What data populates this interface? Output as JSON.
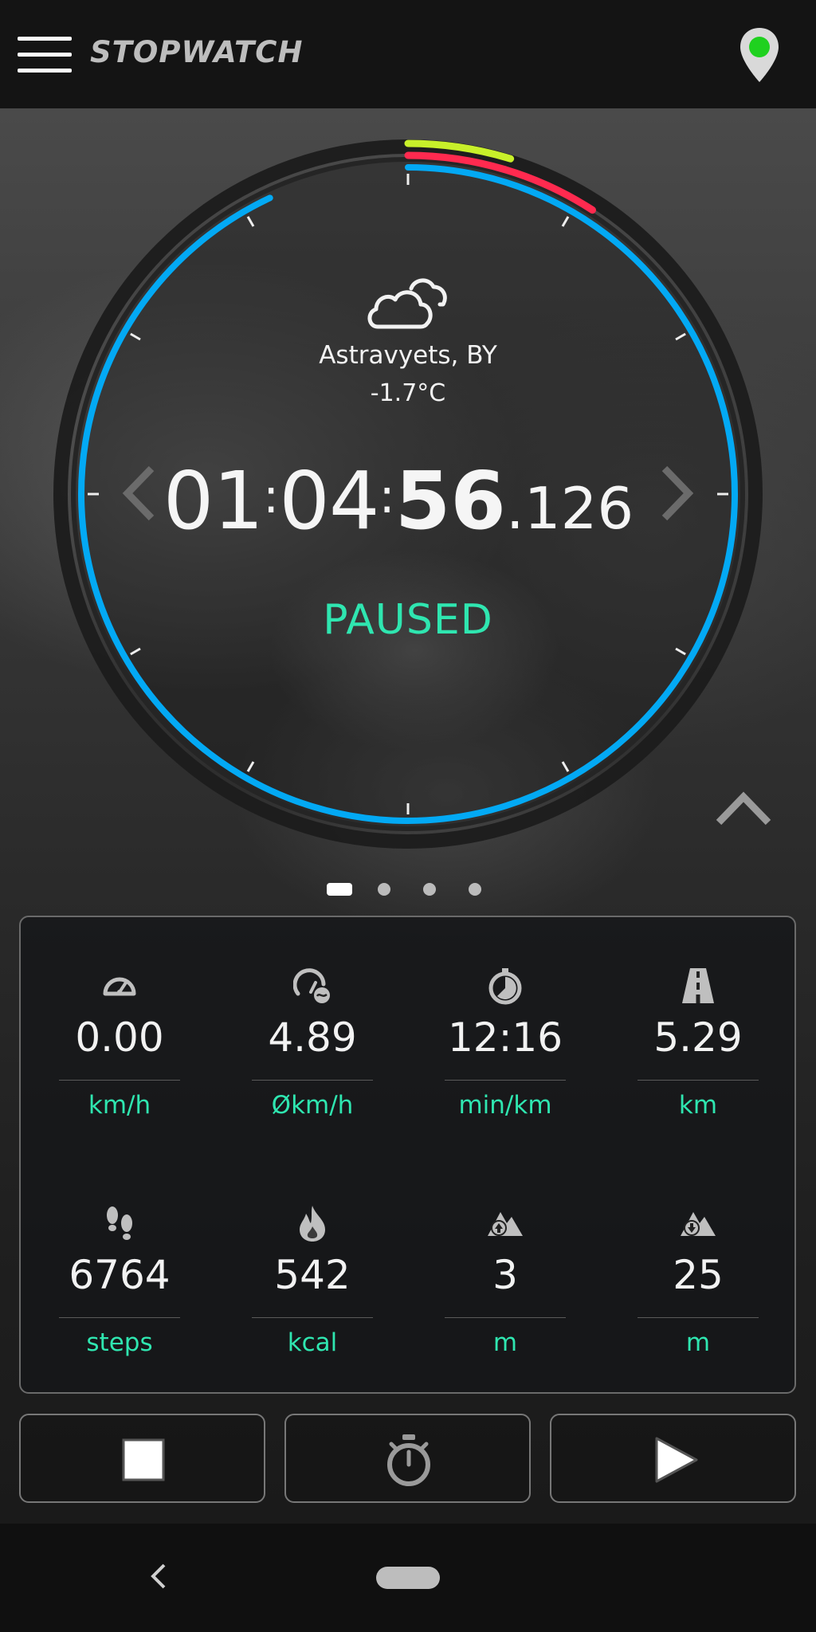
{
  "header": {
    "title": "STOPWATCH",
    "menu_icon": "hamburger-menu-icon",
    "gps_icon": "location-pin-icon",
    "gps_status_color": "#1fd11f"
  },
  "weather": {
    "icon": "cloudy-icon",
    "location": "Astravyets, BY",
    "temperature": "-1.7°C"
  },
  "timer": {
    "hours": "01",
    "minutes": "04",
    "seconds": "56",
    "milliseconds": ".126",
    "separator": ":",
    "status": "PAUSED"
  },
  "dial_colors": {
    "ring": "#03a9f4",
    "goal_red": "#ff2a4f",
    "goal_yellow": "#c8f02a",
    "status": "#2fe6b0"
  },
  "pager": {
    "count": 4,
    "active_index": 0
  },
  "stats": [
    {
      "icon": "speedometer-icon",
      "value": "0.00",
      "unit": "km/h"
    },
    {
      "icon": "average-speed-icon",
      "value": "4.89",
      "unit": "Økm/h"
    },
    {
      "icon": "pace-timer-icon",
      "value": "12:16",
      "unit": "min/km"
    },
    {
      "icon": "road-distance-icon",
      "value": "5.29",
      "unit": "km"
    },
    {
      "icon": "footsteps-icon",
      "value": "6764",
      "unit": "steps"
    },
    {
      "icon": "flame-calories-icon",
      "value": "542",
      "unit": "kcal"
    },
    {
      "icon": "elevation-up-icon",
      "value": "3",
      "unit": "m"
    },
    {
      "icon": "elevation-down-icon",
      "value": "25",
      "unit": "m"
    }
  ],
  "controls": {
    "stop": "stop-icon",
    "lap": "stopwatch-icon",
    "play": "play-icon"
  }
}
